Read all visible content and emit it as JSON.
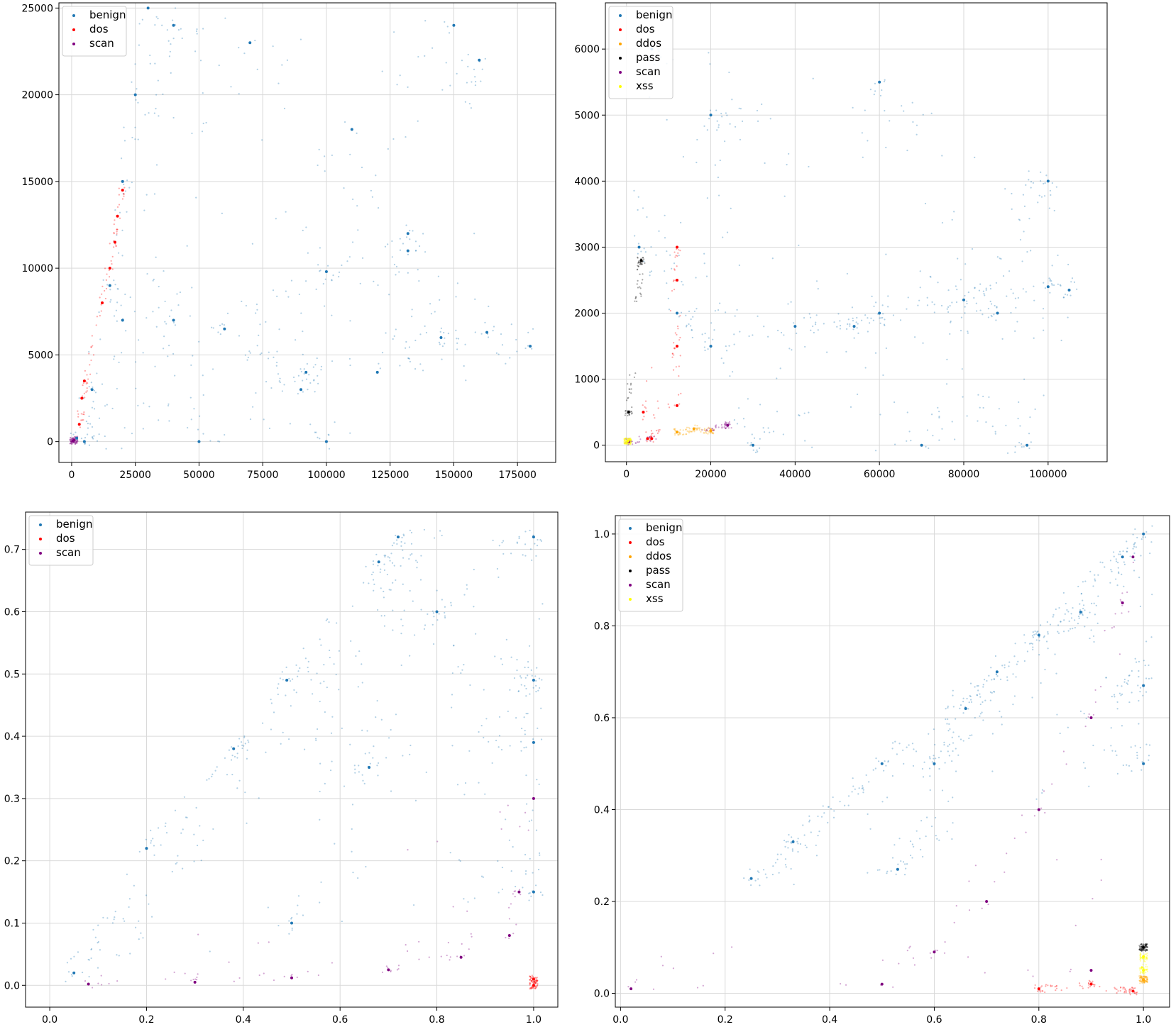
{
  "colors": {
    "benign": "#1f77b4",
    "dos": "#ff0000",
    "ddos": "#ffa500",
    "pass": "#000000",
    "scan": "#800080",
    "xss": "#ffff00",
    "grid": "#d9d9d9"
  },
  "chart_data": [
    {
      "type": "scatter",
      "grid": true,
      "legend_position": "top-left",
      "legend": [
        "benign",
        "dos",
        "scan"
      ],
      "xlim": [
        -5000,
        190000
      ],
      "ylim": [
        -1200,
        25300
      ],
      "xticks": [
        0,
        25000,
        50000,
        75000,
        100000,
        125000,
        150000,
        175000
      ],
      "yticks": [
        0,
        5000,
        10000,
        15000,
        20000,
        25000
      ],
      "xtick_labels": [
        "0",
        "25000",
        "50000",
        "75000",
        "100000",
        "125000",
        "150000",
        "175000"
      ],
      "ytick_labels": [
        "0",
        "5000",
        "10000",
        "15000",
        "20000",
        "25000"
      ],
      "series": [
        {
          "name": "benign",
          "color": "#1f77b4",
          "points": [
            [
              2000,
              200
            ],
            [
              8000,
              3000
            ],
            [
              15000,
              9000
            ],
            [
              20000,
              15000
            ],
            [
              25000,
              20000
            ],
            [
              30000,
              25000
            ],
            [
              40000,
              24000
            ],
            [
              20000,
              7000
            ],
            [
              40000,
              7000
            ],
            [
              60000,
              6500
            ],
            [
              90000,
              3000
            ],
            [
              92000,
              4000
            ],
            [
              100000,
              9800
            ],
            [
              120000,
              4000
            ],
            [
              132000,
              12000
            ],
            [
              132000,
              11000
            ],
            [
              145000,
              6000
            ],
            [
              160000,
              22000
            ],
            [
              163000,
              6300
            ],
            [
              180000,
              5500
            ],
            [
              150000,
              24000
            ],
            [
              70000,
              23000
            ],
            [
              110000,
              18000
            ],
            [
              5000,
              0
            ],
            [
              50000,
              0
            ],
            [
              100000,
              0
            ]
          ]
        },
        {
          "name": "dos",
          "color": "#ff0000",
          "points": [
            [
              3000,
              1000
            ],
            [
              4000,
              2500
            ],
            [
              5000,
              3500
            ],
            [
              12000,
              8000
            ],
            [
              15000,
              10000
            ],
            [
              17000,
              11500
            ],
            [
              18000,
              13000
            ],
            [
              20000,
              14500
            ]
          ]
        },
        {
          "name": "scan",
          "color": "#800080",
          "points": [
            [
              500,
              50
            ],
            [
              1000,
              100
            ]
          ]
        }
      ]
    },
    {
      "type": "scatter",
      "grid": true,
      "legend_position": "top-left",
      "legend": [
        "benign",
        "dos",
        "ddos",
        "pass",
        "scan",
        "xss"
      ],
      "xlim": [
        -5000,
        114000
      ],
      "ylim": [
        -250,
        6700
      ],
      "xticks": [
        0,
        20000,
        40000,
        60000,
        80000,
        100000
      ],
      "yticks": [
        0,
        1000,
        2000,
        3000,
        4000,
        5000,
        6000
      ],
      "xtick_labels": [
        "0",
        "20000",
        "40000",
        "60000",
        "80000",
        "100000"
      ],
      "ytick_labels": [
        "0",
        "1000",
        "2000",
        "3000",
        "4000",
        "5000",
        "6000"
      ],
      "series": [
        {
          "name": "benign",
          "color": "#1f77b4",
          "points": [
            [
              3000,
              3000
            ],
            [
              6000,
              6000
            ],
            [
              12000,
              2000
            ],
            [
              20000,
              1500
            ],
            [
              40000,
              1800
            ],
            [
              60000,
              2000
            ],
            [
              80000,
              2200
            ],
            [
              100000,
              2400
            ],
            [
              105000,
              2350
            ],
            [
              88000,
              2000
            ],
            [
              54000,
              1800
            ],
            [
              20000,
              5000
            ],
            [
              60000,
              5500
            ],
            [
              100000,
              4000
            ],
            [
              30000,
              0
            ],
            [
              70000,
              0
            ],
            [
              95000,
              0
            ]
          ]
        },
        {
          "name": "dos",
          "color": "#ff0000",
          "points": [
            [
              12000,
              600
            ],
            [
              12000,
              1500
            ],
            [
              12000,
              2500
            ],
            [
              12000,
              3000
            ],
            [
              4000,
              500
            ],
            [
              5000,
              100
            ],
            [
              6000,
              100
            ]
          ]
        },
        {
          "name": "ddos",
          "color": "#ffa500",
          "points": [
            [
              12000,
              200
            ],
            [
              16000,
              250
            ],
            [
              20000,
              220
            ]
          ]
        },
        {
          "name": "pass",
          "color": "#000000",
          "points": [
            [
              3500,
              2800
            ],
            [
              500,
              500
            ]
          ]
        },
        {
          "name": "scan",
          "color": "#800080",
          "points": [
            [
              500,
              50
            ],
            [
              24000,
              300
            ]
          ]
        },
        {
          "name": "xss",
          "color": "#ffff00",
          "points": [
            [
              300,
              60
            ]
          ]
        }
      ]
    },
    {
      "type": "scatter",
      "grid": true,
      "legend_position": "top-left",
      "legend": [
        "benign",
        "dos",
        "scan"
      ],
      "xlim": [
        -0.05,
        1.05
      ],
      "ylim": [
        -0.035,
        0.76
      ],
      "xticks": [
        0.0,
        0.2,
        0.4,
        0.6,
        0.8,
        1.0
      ],
      "yticks": [
        0.0,
        0.1,
        0.2,
        0.3,
        0.4,
        0.5,
        0.6,
        0.7
      ],
      "xtick_labels": [
        "0.0",
        "0.2",
        "0.4",
        "0.6",
        "0.8",
        "1.0"
      ],
      "ytick_labels": [
        "0.0",
        "0.1",
        "0.2",
        "0.3",
        "0.4",
        "0.5",
        "0.6",
        "0.7"
      ],
      "series": [
        {
          "name": "benign",
          "color": "#1f77b4",
          "points": [
            [
              0.05,
              0.02
            ],
            [
              0.2,
              0.22
            ],
            [
              0.38,
              0.38
            ],
            [
              0.49,
              0.49
            ],
            [
              0.68,
              0.68
            ],
            [
              0.72,
              0.72
            ],
            [
              1.0,
              0.72
            ],
            [
              1.0,
              0.49
            ],
            [
              1.0,
              0.39
            ],
            [
              1.0,
              0.15
            ],
            [
              0.5,
              0.1
            ],
            [
              0.66,
              0.35
            ],
            [
              0.8,
              0.6
            ]
          ]
        },
        {
          "name": "dos",
          "color": "#ff0000",
          "points": [
            [
              1.0,
              0.0
            ],
            [
              1.0,
              0.01
            ]
          ]
        },
        {
          "name": "scan",
          "color": "#800080",
          "points": [
            [
              0.08,
              0.002
            ],
            [
              0.3,
              0.005
            ],
            [
              0.5,
              0.012
            ],
            [
              0.7,
              0.025
            ],
            [
              0.85,
              0.045
            ],
            [
              0.95,
              0.08
            ],
            [
              0.97,
              0.15
            ],
            [
              1.0,
              0.3
            ]
          ]
        }
      ]
    },
    {
      "type": "scatter",
      "grid": true,
      "legend_position": "top-left",
      "legend": [
        "benign",
        "dos",
        "ddos",
        "pass",
        "scan",
        "xss"
      ],
      "xlim": [
        -0.01,
        1.05
      ],
      "ylim": [
        -0.03,
        1.04
      ],
      "xticks": [
        0.0,
        0.2,
        0.4,
        0.6,
        0.8,
        1.0
      ],
      "yticks": [
        0.0,
        0.2,
        0.4,
        0.6,
        0.8,
        1.0
      ],
      "xtick_labels": [
        "0.0",
        "0.2",
        "0.4",
        "0.6",
        "0.8",
        "1.0"
      ],
      "ytick_labels": [
        "0.0",
        "0.2",
        "0.4",
        "0.6",
        "0.8",
        "1.0"
      ],
      "series": [
        {
          "name": "benign",
          "color": "#1f77b4",
          "points": [
            [
              0.53,
              0.27
            ],
            [
              0.6,
              0.5
            ],
            [
              0.66,
              0.62
            ],
            [
              0.72,
              0.7
            ],
            [
              0.8,
              0.78
            ],
            [
              0.88,
              0.83
            ],
            [
              0.96,
              0.95
            ],
            [
              1.0,
              1.0
            ],
            [
              1.0,
              0.5
            ],
            [
              1.0,
              0.67
            ],
            [
              0.5,
              0.5
            ],
            [
              0.33,
              0.33
            ],
            [
              0.25,
              0.25
            ]
          ]
        },
        {
          "name": "dos",
          "color": "#ff0000",
          "points": [
            [
              0.8,
              0.01
            ],
            [
              0.9,
              0.02
            ],
            [
              0.98,
              0.005
            ]
          ]
        },
        {
          "name": "ddos",
          "color": "#ffa500",
          "points": [
            [
              1.0,
              0.03
            ]
          ]
        },
        {
          "name": "pass",
          "color": "#000000",
          "points": [
            [
              1.0,
              0.1
            ]
          ]
        },
        {
          "name": "scan",
          "color": "#800080",
          "points": [
            [
              0.02,
              0.01
            ],
            [
              0.5,
              0.02
            ],
            [
              0.9,
              0.05
            ],
            [
              0.6,
              0.09
            ],
            [
              0.7,
              0.2
            ],
            [
              0.8,
              0.4
            ],
            [
              0.9,
              0.6
            ],
            [
              0.96,
              0.85
            ],
            [
              0.98,
              0.95
            ]
          ]
        },
        {
          "name": "xss",
          "color": "#ffff00",
          "points": [
            [
              1.0,
              0.05
            ],
            [
              1.0,
              0.08
            ]
          ]
        }
      ]
    }
  ]
}
